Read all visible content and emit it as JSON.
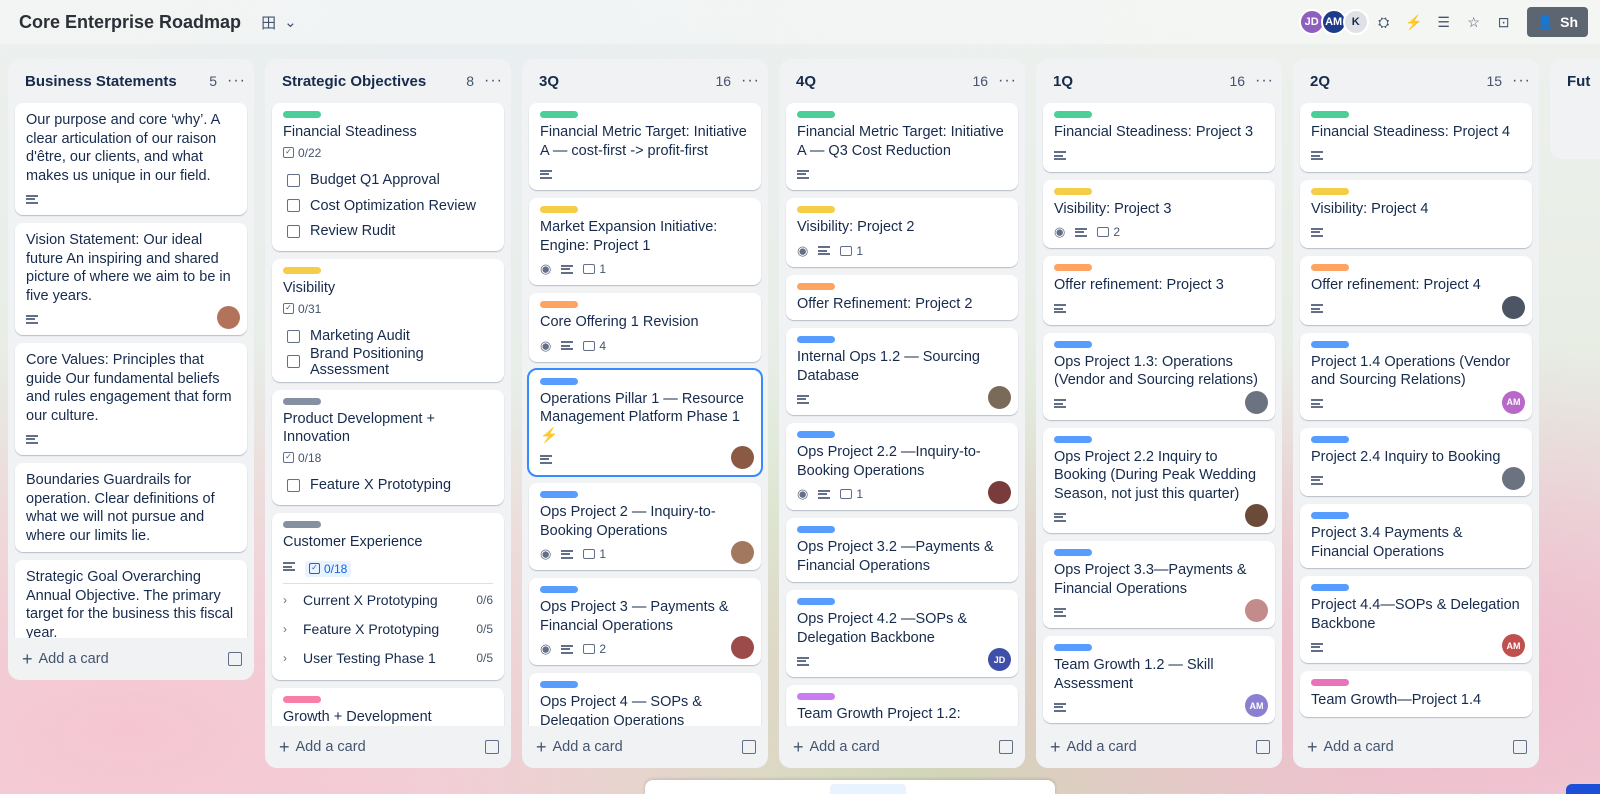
{
  "board": {
    "title": "Core Enterprise Roadmap",
    "view_icon": "田"
  },
  "members": [
    {
      "initials": "JD",
      "color": "#8f5fbf"
    },
    {
      "initials": "AM",
      "color": "#1e3a8a"
    },
    {
      "initials": "K",
      "color": "#dfe1e6"
    }
  ],
  "share_label": "Sh",
  "lists": [
    {
      "title": "Business Statements",
      "count": "5",
      "cards": [
        {
          "title": "Our purpose and core ‘why’. A clear articulation of our raison d'être, our clients, and what makes us unique in our field.",
          "desc": true
        },
        {
          "title": "Vision Statement: Our ideal future An inspiring and shared picture of where we aim to be in five years.",
          "desc": true,
          "member": {
            "initials": "",
            "color": "#b3735a"
          }
        },
        {
          "title": "Core Values: Principles that guide Our fundamental beliefs and rules engagement that form our culture.",
          "desc": true
        },
        {
          "title": "Boundaries Guardrails for operation. Clear definitions of what we will not pursue and where our limits lie."
        },
        {
          "title": "Strategic Goal Overarching Annual Objective. The primary target for the business this fiscal year.",
          "desc": true,
          "member": {
            "initials": "",
            "color": "#9a6b4f"
          }
        }
      ],
      "add_label": "Add a card"
    },
    {
      "title": "Strategic Objectives",
      "count": "8",
      "cards": [
        {
          "label_color": "#4bce97",
          "title": "Financial Steadiness",
          "checklist_badge": "0/22",
          "items": [
            "Budget Q1 Approval",
            "Cost Optimization Review",
            "Review Rudit"
          ]
        },
        {
          "label_color": "#f5cd47",
          "title": "Visibility",
          "checklist_badge": "0/31",
          "items": [
            "Marketing Audit",
            "Brand Positioning Assessment"
          ]
        },
        {
          "label_color": "#8590a2",
          "title": "Product Development + Innovation",
          "checklist_badge": "0/18",
          "items": [
            "Feature X Prototyping"
          ]
        },
        {
          "label_color": "#8590a2",
          "title": "Customer Experience",
          "desc": true,
          "checklist_badge": "0/18",
          "subitems": [
            {
              "label": "Current X Prototyping",
              "count": "0/6"
            },
            {
              "label": "Feature X Prototyping",
              "count": "0/5"
            },
            {
              "label": "User Testing Phase 1",
              "count": "0/5"
            }
          ]
        },
        {
          "label_color": "#f87ea8",
          "title": "Growth + Development"
        }
      ],
      "add_label": "Add a card"
    },
    {
      "title": "3Q",
      "count": "16",
      "cards": [
        {
          "label_color": "#4bce97",
          "title": "Financial Metric Target: Initiative A — cost-first -> profit-first",
          "desc": true
        },
        {
          "label_color": "#f5cd47",
          "title": "Market Expansion Initiative: Engine: Project 1",
          "watch": true,
          "desc": true,
          "comments": "1"
        },
        {
          "label_color": "#fea362",
          "title": "Core Offering 1 Revision",
          "watch": true,
          "desc": true,
          "comments": "4"
        },
        {
          "label_color": "#579dff",
          "title": "Operations Pillar 1 — Resource Management Platform Phase 1 ⚡",
          "desc": true,
          "selected": true,
          "member": {
            "initials": "",
            "color": "#8a5a44"
          }
        },
        {
          "label_color": "#579dff",
          "title": "Ops Project 2 — Inquiry-to-Booking Operations",
          "watch": true,
          "desc": true,
          "comments": "1",
          "member": {
            "initials": "",
            "color": "#a2785e"
          }
        },
        {
          "label_color": "#579dff",
          "title": "Ops Project 3 — Payments & Financial Operations",
          "watch": true,
          "desc": true,
          "comments": "2",
          "member": {
            "initials": "",
            "color": "#9c4a4a"
          }
        },
        {
          "label_color": "#579dff",
          "title": "Ops Project 4 — SOPs & Delegation Operations"
        }
      ],
      "add_label": "Add a card"
    },
    {
      "title": "4Q",
      "count": "16",
      "cards": [
        {
          "label_color": "#4bce97",
          "title": "Financial Metric Target: Initiative A — Q3 Cost Reduction",
          "desc": true
        },
        {
          "label_color": "#f5cd47",
          "title": "Visibility: Project 2",
          "watch": true,
          "desc": true,
          "comments": "1"
        },
        {
          "label_color": "#fea362",
          "title": "Offer Refinement: Project 2"
        },
        {
          "label_color": "#579dff",
          "title": "Internal Ops 1.2 — Sourcing Database",
          "desc": true,
          "member": {
            "initials": "",
            "color": "#7a6a5a"
          }
        },
        {
          "label_color": "#579dff",
          "title": "Ops Project 2.2 —Inquiry-to-Booking Operations",
          "watch": true,
          "desc": true,
          "comments": "1",
          "member": {
            "initials": "",
            "color": "#7a3b3b"
          }
        },
        {
          "label_color": "#579dff",
          "title": "Ops Project 3.2 —Payments & Financial Operations"
        },
        {
          "label_color": "#579dff",
          "title": "Ops Project 4.2 —SOPs & Delegation Backbone",
          "desc": true,
          "member": {
            "initials": "JD",
            "color": "#3d4fa8"
          }
        },
        {
          "label_color": "#c97cf4",
          "title": "Team Growth Project 1.2:"
        }
      ],
      "add_label": "Add a card"
    },
    {
      "title": "1Q",
      "count": "16",
      "cards": [
        {
          "label_color": "#4bce97",
          "title": "Financial Steadiness: Project 3",
          "desc": true
        },
        {
          "label_color": "#f5cd47",
          "title": "Visibility: Project 3",
          "watch": true,
          "desc": true,
          "comments": "2"
        },
        {
          "label_color": "#fea362",
          "title": "Offer refinement: Project 3",
          "desc": true
        },
        {
          "label_color": "#579dff",
          "title": "Ops Project 1.3: Operations (Vendor and Sourcing relations)",
          "desc": true,
          "member": {
            "initials": "",
            "color": "#6b7280"
          }
        },
        {
          "label_color": "#579dff",
          "title": "Ops Project 2.2 Inquiry to Booking (During Peak Wedding Season, not just this quarter)",
          "desc": true,
          "member": {
            "initials": "",
            "color": "#6b4a3a"
          }
        },
        {
          "label_color": "#579dff",
          "title": "Ops Project 3.3—Payments & Financial Operations",
          "desc": true,
          "member": {
            "initials": "",
            "color": "#c48b8b"
          }
        },
        {
          "label_color": "#579dff",
          "title": "Team Growth 1.2 — Skill Assessment",
          "desc": true,
          "member": {
            "initials": "AM",
            "color": "#8b7fd1"
          }
        }
      ],
      "add_label": "Add a card"
    },
    {
      "title": "2Q",
      "count": "15",
      "cards": [
        {
          "label_color": "#4bce97",
          "title": "Financial Steadiness: Project 4",
          "desc": true
        },
        {
          "label_color": "#f5cd47",
          "title": "Visibility: Project 4",
          "desc": true
        },
        {
          "label_color": "#fea362",
          "title": "Offer refinement: Project 4",
          "desc": true,
          "member": {
            "initials": "",
            "color": "#4b5563"
          }
        },
        {
          "label_color": "#579dff",
          "title": "Project 1.4 Operations (Vendor and Sourcing Relations)",
          "desc": true,
          "member": {
            "initials": "AM",
            "color": "#b768c9"
          }
        },
        {
          "label_color": "#579dff",
          "title": "Project 2.4 Inquiry to Booking",
          "desc": true,
          "member": {
            "initials": "",
            "color": "#6b7280"
          }
        },
        {
          "label_color": "#579dff",
          "title": "Project 3.4 Payments & Financial Operations"
        },
        {
          "label_color": "#579dff",
          "title": "Project 4.4—SOPs & Delegation Backbone",
          "desc": true,
          "member": {
            "initials": "AM",
            "color": "#c0504d"
          }
        },
        {
          "label_color": "#e774bb",
          "title": "Team Growth—Project 1.4"
        }
      ],
      "add_label": "Add a card"
    },
    {
      "title": "Fut",
      "peek": true
    }
  ]
}
